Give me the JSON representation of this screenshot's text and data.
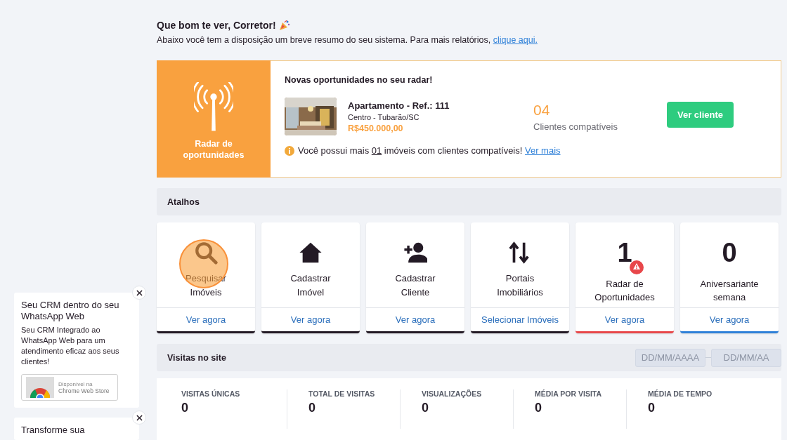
{
  "greeting": {
    "title": "Que bom te ver, Corretor!",
    "text": "Abaixo você tem a disposição um breve resumo do seu sistema. Para mais relatórios,",
    "link": "clique aqui."
  },
  "radar": {
    "label": "Radar de oportunidades",
    "heading": "Novas oportunidades no seu radar!",
    "property": {
      "kind": "picture",
      "title": "Apartamento - Ref.: 111",
      "location": "Centro - Tubarão/SC",
      "price": "R$450.000,00"
    },
    "count": "04",
    "count_label": "Clientes compatíveis",
    "button": "Ver cliente",
    "notice": {
      "before": "Você possui mais",
      "count": "01",
      "after": "imóveis com clientes compatíveis!",
      "link": "Ver mais"
    }
  },
  "shortcuts": {
    "title": "Atalhos",
    "items": [
      {
        "kind": "icon",
        "highlighted": true,
        "label": "Pesquisar Imóveis",
        "action": "Ver agora",
        "color": "#231a25"
      },
      {
        "kind": "icon",
        "highlighted": false,
        "label": "Cadastrar Imóvel",
        "action": "Ver agora",
        "color": "#231a25"
      },
      {
        "kind": "icon",
        "highlighted": false,
        "label": "Cadastrar Cliente",
        "action": "Ver agora",
        "color": "#231a25"
      },
      {
        "kind": "icon",
        "highlighted": false,
        "label": "Portais Imobiliários",
        "action": "Selecionar Imóveis",
        "color": "#231a25"
      },
      {
        "kind": "count",
        "highlighted": false,
        "count": "1",
        "warning": true,
        "label": "Radar de Oportunidades",
        "action": "Ver agora",
        "color": "#e8474a"
      },
      {
        "kind": "count",
        "highlighted": false,
        "count": "0",
        "warning": false,
        "label": "Aniversariante semana",
        "action": "Ver agora",
        "color": "#2f80d8"
      }
    ]
  },
  "visits": {
    "title": "Visitas no site",
    "date_from": {
      "placeholder": "DD/MM/AAAA"
    },
    "date_to": {
      "placeholder": "DD/MM/AA"
    },
    "stats": [
      {
        "label": "VISITAS ÚNICAS",
        "value": "0"
      },
      {
        "label": "TOTAL DE VISITAS",
        "value": "0"
      },
      {
        "label": "VISUALIZAÇÕES",
        "value": "0"
      },
      {
        "label": "MÉDIA POR VISITA",
        "value": "0"
      },
      {
        "label": "MÉDIA DE TEMPO",
        "value": "0"
      }
    ]
  },
  "promos": [
    {
      "title": "Seu CRM dentro do seu WhatsApp Web",
      "text": "Seu CRM Integrado ao WhatsApp Web para um atendimento eficaz aos seus clientes!",
      "badge_small": "Disponível na",
      "badge": "Chrome Web Store"
    },
    {
      "title": "Transforme sua"
    }
  ]
}
